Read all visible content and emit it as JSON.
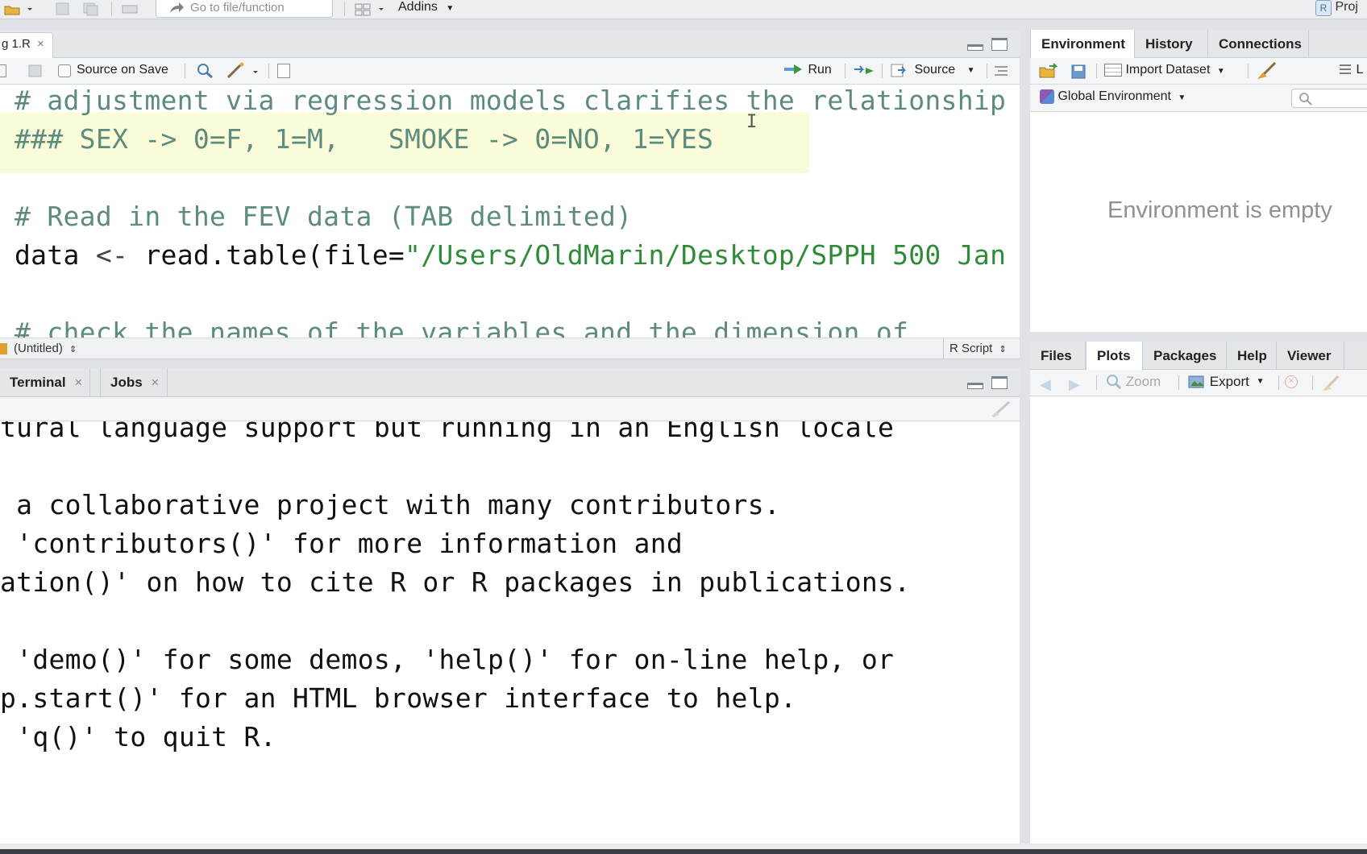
{
  "toolbar": {
    "goto_placeholder": "Go to file/function",
    "addins_label": "Addins",
    "project_label": "Proj"
  },
  "source": {
    "tab_label": "g 1.R",
    "source_on_save_label": "Source on Save",
    "run_label": "Run",
    "source_label": "Source",
    "status_left": "(Untitled)",
    "status_right": "R Script",
    "lines": [
      "# adjustment via regression models clarifies the relationship",
      "### SEX -> 0=F, 1=M,   SMOKE -> 0=NO, 1=YES",
      "",
      "# Read in the FEV data (TAB delimited)",
      "data <- read.table(file=\"/Users/OldMarin/Desktop/SPPH 500 Jan",
      "",
      "# check the names of the variables and the dimension of"
    ],
    "line4_parts": {
      "var": "data ",
      "assign": "<-",
      "fn": " read.table(file=",
      "str": "\"/Users/OldMarin/Desktop/SPPH 500 Jan"
    }
  },
  "console": {
    "tabs": [
      "Terminal",
      "Jobs"
    ],
    "lines": [
      "tural language support but running in an English locale",
      "",
      " a collaborative project with many contributors.",
      " 'contributors()' for more information and",
      "ation()' on how to cite R or R packages in publications.",
      "",
      " 'demo()' for some demos, 'help()' for on-line help, or",
      "p.start()' for an HTML browser interface to help.",
      " 'q()' to quit R."
    ]
  },
  "environment": {
    "tabs": [
      "Environment",
      "History",
      "Connections"
    ],
    "import_label": "Import Dataset",
    "list_label": "L",
    "scope_label": "Global Environment",
    "empty_message": "Environment is empty"
  },
  "files": {
    "tabs": [
      "Files",
      "Plots",
      "Packages",
      "Help",
      "Viewer"
    ],
    "zoom_label": "Zoom",
    "export_label": "Export"
  }
}
